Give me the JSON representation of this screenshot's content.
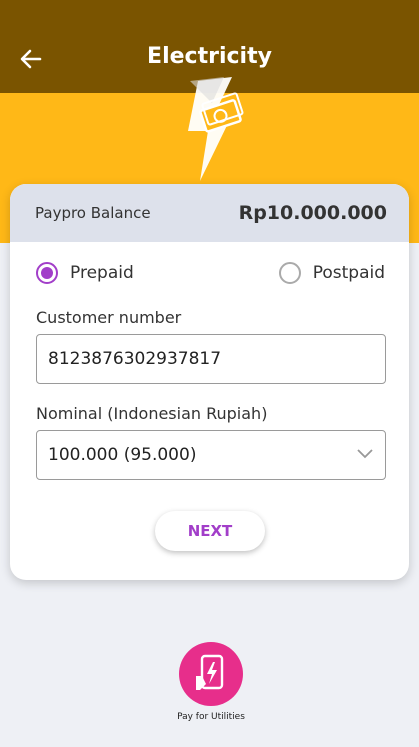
{
  "header": {
    "title": "Electricity",
    "back_icon": "arrow-left-icon"
  },
  "hero": {
    "icon": "lightning-money-icon",
    "color": "#ffb817"
  },
  "colors": {
    "header": "#7a5400",
    "hero": "#ffb817",
    "accent": "#a23ec9",
    "utility": "#e72e8b"
  },
  "balance": {
    "label": "Paypro Balance",
    "value": "Rp10.000.000"
  },
  "payment_type": {
    "options": [
      {
        "label": "Prepaid",
        "selected": true
      },
      {
        "label": "Postpaid",
        "selected": false
      }
    ]
  },
  "customer": {
    "label": "Customer number",
    "value": "8123876302937817"
  },
  "nominal": {
    "label": "Nominal (Indonesian Rupiah)",
    "value": "100.000 (95.000)"
  },
  "next_button": {
    "label": "NEXT"
  },
  "utility": {
    "label": "Pay for Utilities",
    "icon": "phone-bolt-icon"
  }
}
